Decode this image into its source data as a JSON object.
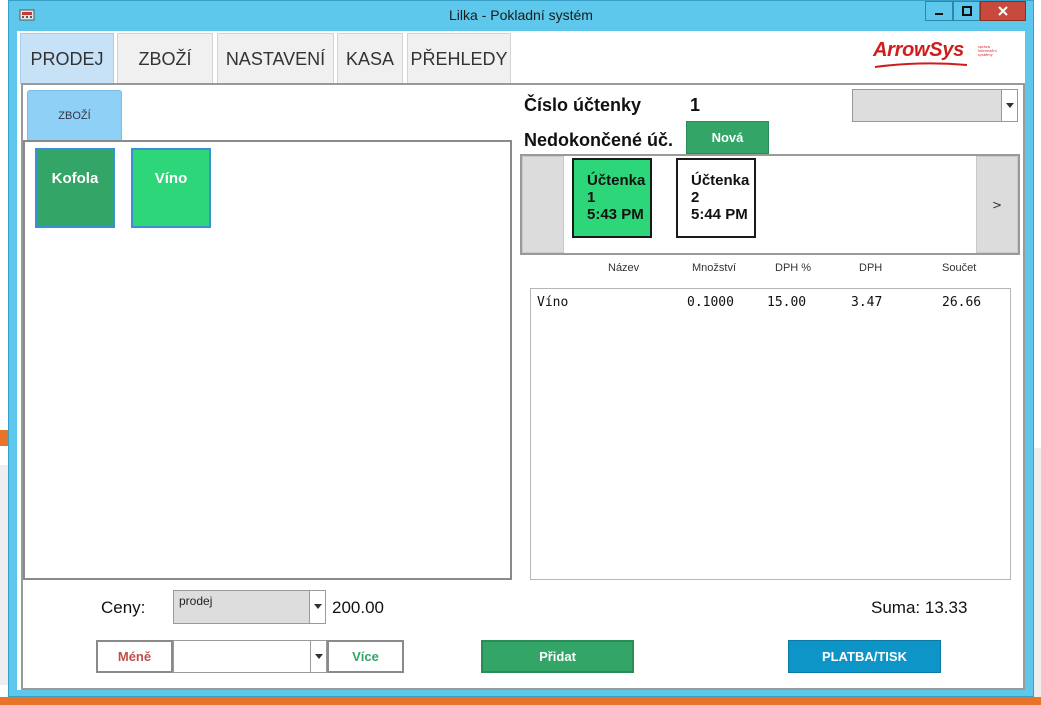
{
  "window": {
    "title": "Lilka - Pokladní systém"
  },
  "tabs": [
    {
      "label": "PRODEJ",
      "active": true
    },
    {
      "label": "ZBOŽÍ",
      "active": false
    },
    {
      "label": "NASTAVENÍ",
      "active": false
    },
    {
      "label": "KASA",
      "active": false
    },
    {
      "label": "PŘEHLEDY",
      "active": false
    }
  ],
  "brand": {
    "name": "ArrowSys",
    "tagline": "správa informační systémy",
    "color": "#d11c1c"
  },
  "goods": {
    "subtab_label": "ZBOŽÍ",
    "products": [
      {
        "label": "Kofola",
        "color": "#32a567"
      },
      {
        "label": "Víno",
        "color": "#2ed67a"
      }
    ]
  },
  "receipt": {
    "number_label": "Číslo účtenky",
    "number_value": "1",
    "unfinished_label": "Nedokončené úč.",
    "new_button": "Nová",
    "next_label": ">",
    "cards": [
      {
        "line1": "Účtenka",
        "line2": "1",
        "time": "5:43 PM",
        "active": true
      },
      {
        "line1": "Účtenka",
        "line2": "2",
        "time": "5:44 PM",
        "active": false
      }
    ],
    "columns": [
      "Název",
      "Množství",
      "DPH %",
      "DPH",
      "Součet"
    ],
    "items": [
      {
        "name": "Víno",
        "quantity": "0.1000",
        "vat_rate": "15.00",
        "vat": "3.47",
        "total": "26.66"
      }
    ]
  },
  "prices": {
    "label": "Ceny:",
    "select_value": "prodej",
    "amount": "200.00"
  },
  "quantity": {
    "less_button": "Méně",
    "more_button": "Více",
    "value": ""
  },
  "actions": {
    "add_button": "Přidat",
    "pay_button": "PLATBA/TISK"
  },
  "summary": {
    "label": "Suma:",
    "value": "13.33"
  },
  "colors": {
    "green": "#32a567",
    "light_green": "#2ed67a",
    "blue": "#0e95c8",
    "less_red": "#c0504d",
    "more_green": "#32a567"
  }
}
